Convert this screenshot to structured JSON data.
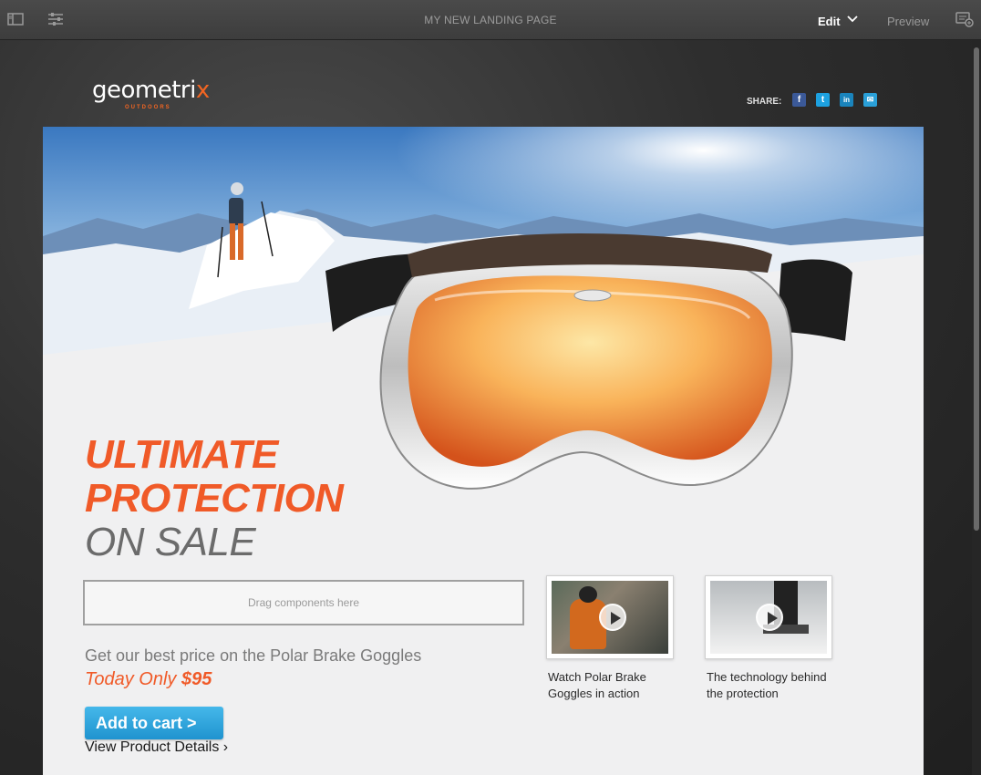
{
  "toolbar": {
    "title": "MY NEW LANDING PAGE",
    "mode_label": "Edit",
    "preview_label": "Preview",
    "icons": [
      "sidebar-toggle-icon",
      "properties-icon",
      "chevron-down-icon",
      "annotate-icon"
    ]
  },
  "brand": {
    "logo_text": "geometri",
    "logo_accent": "x",
    "logo_subtitle": "OUTDOORS",
    "accent_color": "#f26522"
  },
  "share": {
    "label": "SHARE:",
    "buttons": [
      {
        "name": "facebook",
        "glyph": "f",
        "color": "#3b5998"
      },
      {
        "name": "twitter",
        "glyph": "t",
        "color": "#1da1e0"
      },
      {
        "name": "linkedin",
        "glyph": "in",
        "color": "#1a84bc"
      },
      {
        "name": "email",
        "glyph": "✉",
        "color": "#2aa0d8"
      }
    ]
  },
  "hero": {
    "headline_line1": "ULTIMATE",
    "headline_line2": "PROTECTION",
    "headline_line3": "ON SALE"
  },
  "dropzone": {
    "label": "Drag components here"
  },
  "offer": {
    "text": "Get our best price on the Polar Brake Goggles",
    "today_label": "Today Only",
    "price": "$95",
    "cart_label": "Add to cart  >",
    "details_label": "View Product Details ›"
  },
  "videos": [
    {
      "caption_line1": "Watch Polar Brake",
      "caption_line2": "Goggles in action"
    },
    {
      "caption_line1": "The technology behind",
      "caption_line2": "the protection"
    }
  ]
}
